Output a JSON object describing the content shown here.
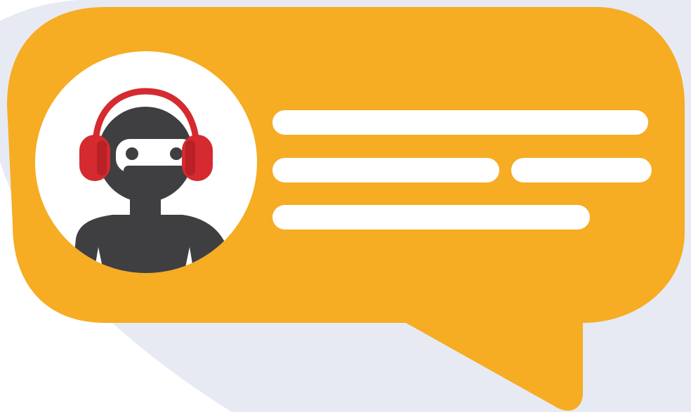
{
  "colors": {
    "background": "#FFFFFF",
    "backdrop_shape": "#E7EAF3",
    "bubble": "#F6AC23",
    "avatar_circle": "#FFFFFF",
    "text_placeholder": "#FFFFFF",
    "robot_body": "#3F3F41",
    "robot_visor": "#FFFFFF",
    "headphones": "#D52A2F"
  },
  "bubble": {
    "avatar": {
      "icon": "robot-support-agent-icon",
      "accessory": "headphones"
    },
    "text_lines": [
      {
        "line": 1,
        "segments": 1
      },
      {
        "line": 2,
        "segments": 2
      },
      {
        "line": 3,
        "segments": 1
      }
    ]
  }
}
